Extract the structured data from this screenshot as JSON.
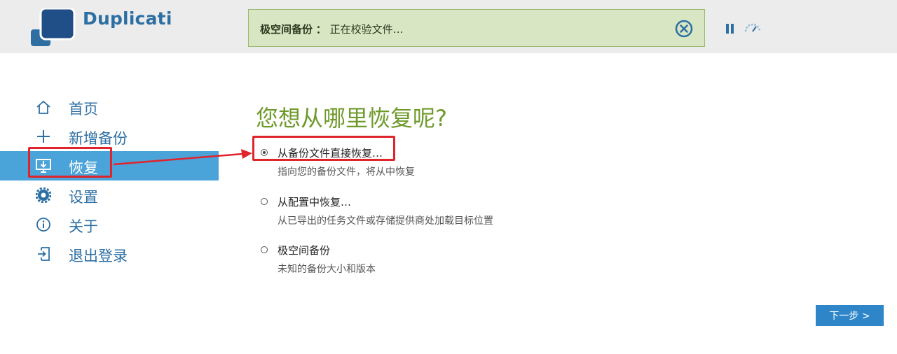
{
  "app": {
    "name": "Duplicati"
  },
  "status": {
    "backup_name": "极空间备份",
    "separator": "：",
    "message": "正在校验文件…",
    "colors": {
      "background": "#d8e6c4",
      "border": "#9ab86f"
    },
    "icons": {
      "cancel": "close-circle-icon",
      "pause": "pause-icon",
      "throttle": "speed-gauge-icon"
    }
  },
  "nav": {
    "items": [
      {
        "label": "首页",
        "icon": "home-icon",
        "active": false
      },
      {
        "label": "新增备份",
        "icon": "plus-icon",
        "active": false
      },
      {
        "label": "恢复",
        "icon": "restore-icon",
        "active": true
      },
      {
        "label": "设置",
        "icon": "gear-icon",
        "active": false
      },
      {
        "label": "关于",
        "icon": "info-icon",
        "active": false
      },
      {
        "label": "退出登录",
        "icon": "logout-icon",
        "active": false
      }
    ],
    "colors": {
      "text": "#2d6fa3",
      "active_bg": "#4aa3d9"
    }
  },
  "main": {
    "title": "您想从哪里恢复呢?",
    "options": [
      {
        "label": "从备份文件直接恢复…",
        "description": "指向您的备份文件，将从中恢复",
        "selected": true
      },
      {
        "label": "从配置中恢复…",
        "description": "从已导出的任务文件或存储提供商处加载目标位置",
        "selected": false
      },
      {
        "label": "极空间备份",
        "description": "未知的备份大小和版本",
        "selected": false
      }
    ],
    "next_button": "下一步 >"
  },
  "annotation": {
    "highlight_color": "#e0242c"
  }
}
